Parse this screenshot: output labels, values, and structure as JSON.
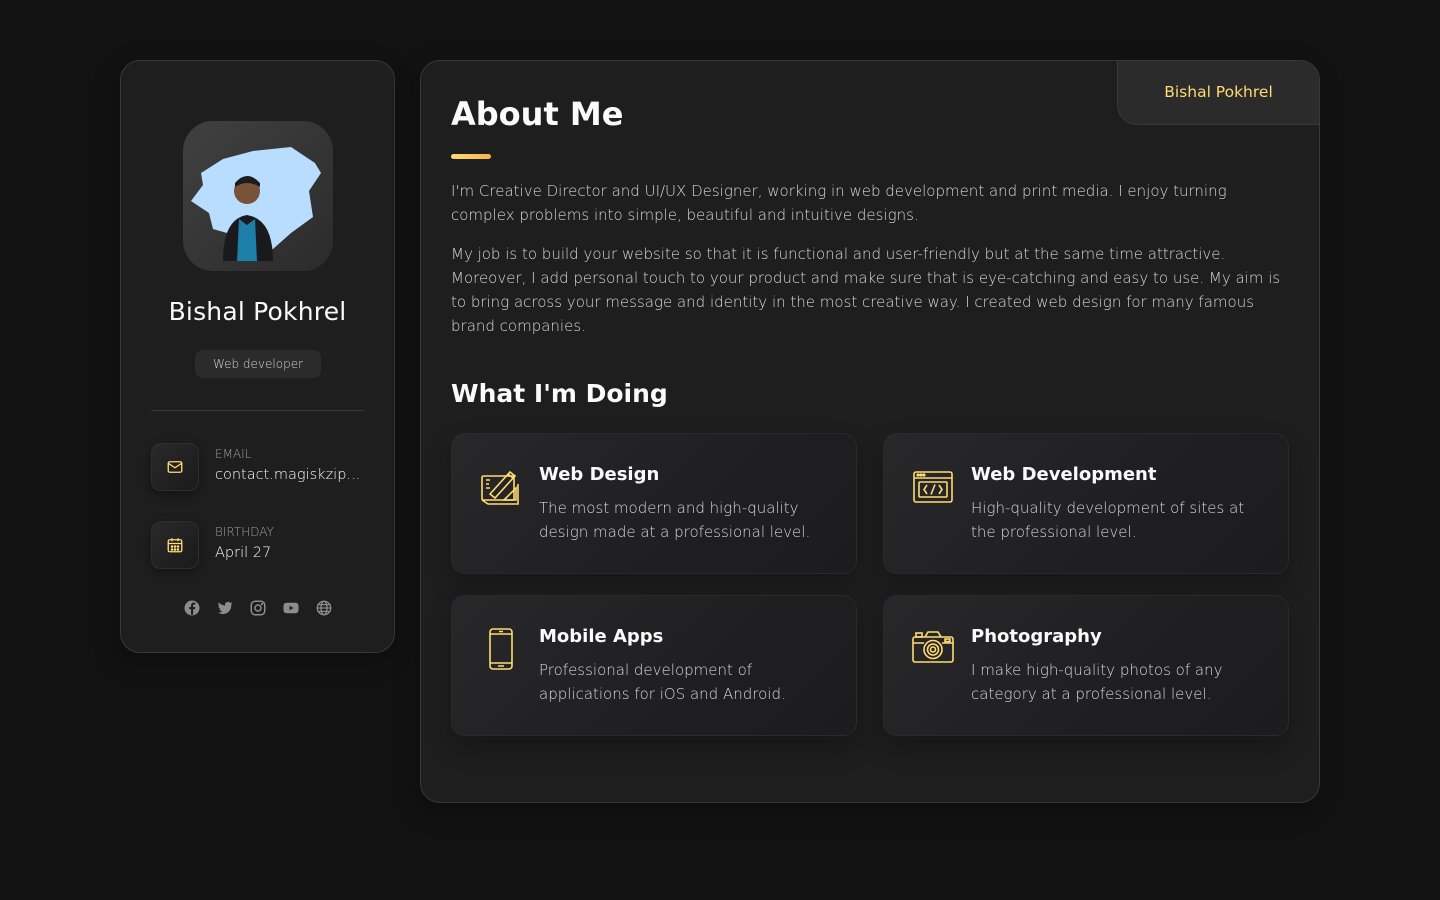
{
  "sidebar": {
    "name": "Bishal Pokhrel",
    "title": "Web developer",
    "contacts": [
      {
        "label": "Email",
        "value": "contact.magiskzip...",
        "icon": "mail-icon"
      },
      {
        "label": "Birthday",
        "value": "April 27",
        "icon": "calendar-icon"
      }
    ],
    "socials": [
      "facebook-icon",
      "twitter-icon",
      "instagram-icon",
      "youtube-icon",
      "globe-icon"
    ]
  },
  "navbar": {
    "active_tab": "Bishal Pokhrel"
  },
  "about": {
    "title": "About Me",
    "paragraphs": [
      "I'm Creative Director and UI/UX Designer, working in web development and print media. I enjoy turning complex problems into simple, beautiful and intuitive designs.",
      "My job is to build your website so that it is functional and user-friendly but at the same time attractive. Moreover, I add personal touch to your product and make sure that is eye-catching and easy to use. My aim is to bring across your message and identity in the most creative way. I created web design for many famous brand companies."
    ]
  },
  "services": {
    "title": "What I'm Doing",
    "items": [
      {
        "title": "Web Design",
        "text": "The most modern and high-quality design made at a professional level.",
        "icon": "design-icon"
      },
      {
        "title": "Web Development",
        "text": "High-quality development of sites at the professional level.",
        "icon": "code-icon"
      },
      {
        "title": "Mobile Apps",
        "text": "Professional development of applications for iOS and Android.",
        "icon": "mobile-icon"
      },
      {
        "title": "Photography",
        "text": "I make high-quality photos of any category at a professional level.",
        "icon": "camera-icon"
      }
    ]
  },
  "colors": {
    "accent": "#ffdb70",
    "background": "#121212",
    "card": "#1e1e1f"
  }
}
